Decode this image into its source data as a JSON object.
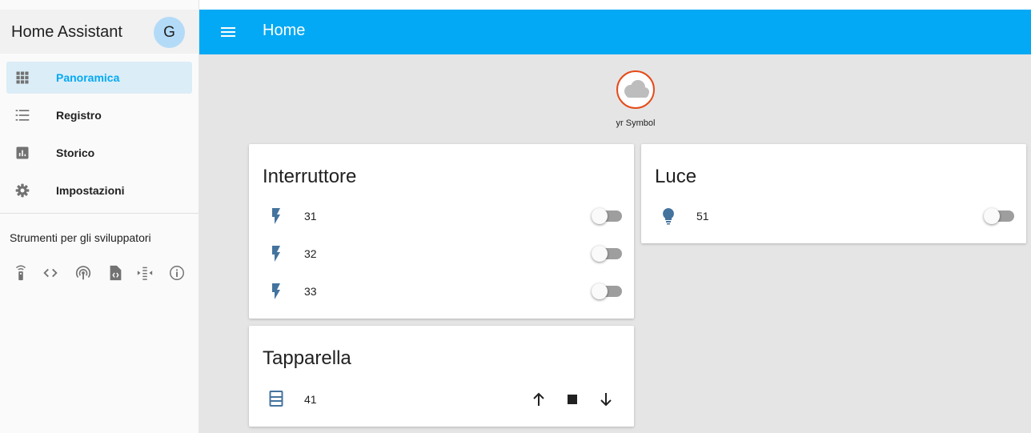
{
  "app": {
    "title": "Home Assistant",
    "avatar_initial": "G"
  },
  "sidebar": {
    "items": [
      {
        "label": "Panoramica",
        "icon": "grid-icon",
        "active": true
      },
      {
        "label": "Registro",
        "icon": "list-icon",
        "active": false
      },
      {
        "label": "Storico",
        "icon": "chart-icon",
        "active": false
      },
      {
        "label": "Impostazioni",
        "icon": "gear-icon",
        "active": false
      }
    ],
    "dev_tools_title": "Strumenti per gli sviluppatori",
    "dev_tools_icons": [
      "remote-icon",
      "code-tags-icon",
      "access-point-icon",
      "file-code-icon",
      "format-indent-icon",
      "info-icon"
    ]
  },
  "header": {
    "title": "Home"
  },
  "weather": {
    "label": "yr Symbol",
    "icon": "cloud-icon"
  },
  "cards": {
    "interruttore": {
      "title": "Interruttore",
      "rows": [
        {
          "label": "31",
          "icon": "flash-icon",
          "state": "off"
        },
        {
          "label": "32",
          "icon": "flash-icon",
          "state": "off"
        },
        {
          "label": "33",
          "icon": "flash-icon",
          "state": "off"
        }
      ]
    },
    "luce": {
      "title": "Luce",
      "rows": [
        {
          "label": "51",
          "icon": "lightbulb-icon",
          "state": "off"
        }
      ]
    },
    "tapparella": {
      "title": "Tapparella",
      "rows": [
        {
          "label": "41",
          "icon": "window-shutter-icon",
          "controls": [
            "arrow-up-icon",
            "stop-icon",
            "arrow-down-icon"
          ]
        }
      ]
    }
  },
  "colors": {
    "accent": "#03a9f4",
    "icon": "#44739e",
    "weather_border": "#e64a19"
  }
}
